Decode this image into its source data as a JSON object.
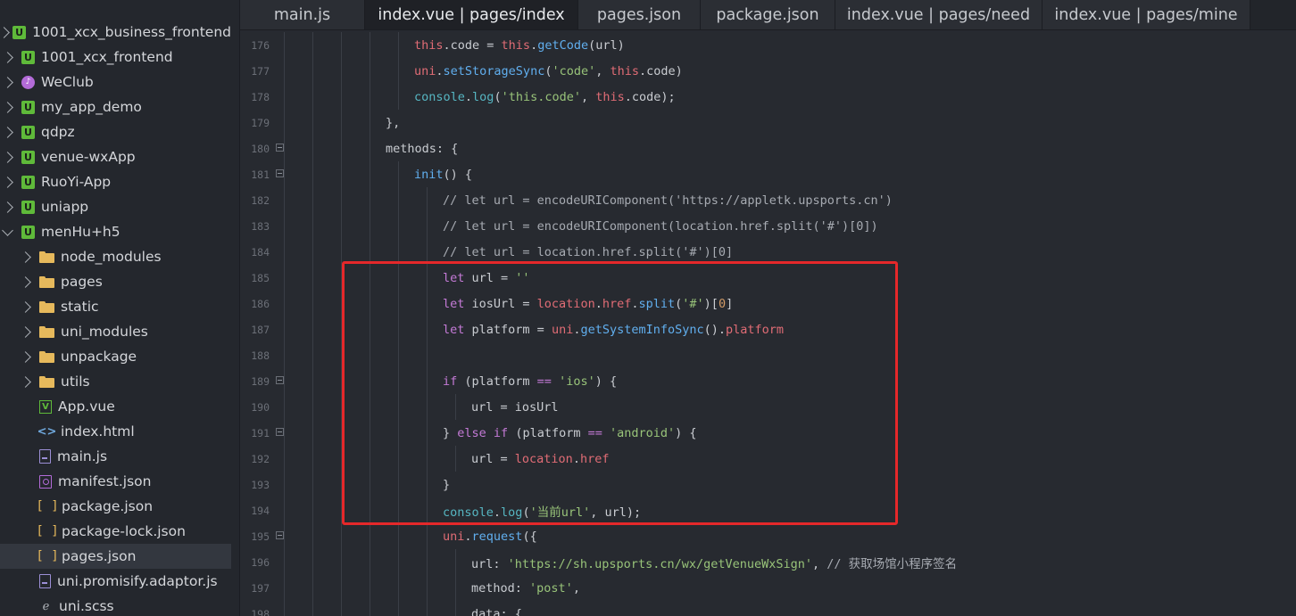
{
  "sidebar": {
    "items": [
      {
        "label": "1001_xcx_business_frontend",
        "icon": "uniapp-project-icon",
        "chevron": "right",
        "indent": 0,
        "selected": false
      },
      {
        "label": "1001_xcx_frontend",
        "icon": "uniapp-project-icon",
        "chevron": "right",
        "indent": 0,
        "selected": false
      },
      {
        "label": "WeClub",
        "icon": "weclub-project-icon",
        "chevron": "right",
        "indent": 0,
        "selected": false
      },
      {
        "label": "my_app_demo",
        "icon": "uniapp-project-icon",
        "chevron": "right",
        "indent": 0,
        "selected": false
      },
      {
        "label": "qdpz",
        "icon": "uniapp-project-icon",
        "chevron": "right",
        "indent": 0,
        "selected": false
      },
      {
        "label": "venue-wxApp",
        "icon": "uniapp-project-icon",
        "chevron": "right",
        "indent": 0,
        "selected": false
      },
      {
        "label": "RuoYi-App",
        "icon": "uniapp-project-icon",
        "chevron": "right",
        "indent": 0,
        "selected": false
      },
      {
        "label": "uniapp",
        "icon": "uniapp-project-icon",
        "chevron": "right",
        "indent": 0,
        "selected": false
      },
      {
        "label": "menHu+h5",
        "icon": "uniapp-project-icon",
        "chevron": "down",
        "indent": 0,
        "selected": false
      },
      {
        "label": "node_modules",
        "icon": "folder-icon",
        "chevron": "right",
        "indent": 1,
        "selected": false
      },
      {
        "label": "pages",
        "icon": "folder-icon",
        "chevron": "right",
        "indent": 1,
        "selected": false
      },
      {
        "label": "static",
        "icon": "folder-icon",
        "chevron": "right",
        "indent": 1,
        "selected": false
      },
      {
        "label": "uni_modules",
        "icon": "folder-icon",
        "chevron": "right",
        "indent": 1,
        "selected": false
      },
      {
        "label": "unpackage",
        "icon": "folder-icon",
        "chevron": "right",
        "indent": 1,
        "selected": false
      },
      {
        "label": "utils",
        "icon": "folder-icon",
        "chevron": "right",
        "indent": 1,
        "selected": false
      },
      {
        "label": "App.vue",
        "icon": "vue-file-icon",
        "chevron": "",
        "indent": 1,
        "selected": false
      },
      {
        "label": "index.html",
        "icon": "html-file-icon",
        "chevron": "",
        "indent": 1,
        "selected": false
      },
      {
        "label": "main.js",
        "icon": "js-file-icon",
        "chevron": "",
        "indent": 1,
        "selected": false
      },
      {
        "label": "manifest.json",
        "icon": "manifest-file-icon",
        "chevron": "",
        "indent": 1,
        "selected": false
      },
      {
        "label": "package.json",
        "icon": "json-file-icon",
        "chevron": "",
        "indent": 1,
        "selected": false
      },
      {
        "label": "package-lock.json",
        "icon": "json-file-icon",
        "chevron": "",
        "indent": 1,
        "selected": false
      },
      {
        "label": "pages.json",
        "icon": "json-file-icon",
        "chevron": "",
        "indent": 1,
        "selected": true
      },
      {
        "label": "uni.promisify.adaptor.js",
        "icon": "js-file-icon",
        "chevron": "",
        "indent": 1,
        "selected": false
      },
      {
        "label": "uni.scss",
        "icon": "scss-file-icon",
        "chevron": "",
        "indent": 1,
        "selected": false
      }
    ]
  },
  "tabs": [
    {
      "label": "main.js",
      "active": false
    },
    {
      "label": "index.vue | pages/index",
      "active": true
    },
    {
      "label": "pages.json",
      "active": false
    },
    {
      "label": "package.json",
      "active": false
    },
    {
      "label": "index.vue | pages/need",
      "active": false
    },
    {
      "label": "index.vue | pages/mine",
      "active": false
    }
  ],
  "colors": {
    "keyword": "#c47ad6",
    "this": "#e06c75",
    "function": "#61afef",
    "object": "#56b6c2",
    "string": "#98c379",
    "comment": "#a7abb2",
    "highlight_box": "#e5282a"
  },
  "editor": {
    "lines": [
      {
        "num": "176",
        "fold": false,
        "indent": 5,
        "tokens": [
          [
            "this",
            "this"
          ],
          [
            ".code = ",
            ""
          ],
          [
            "this",
            "this"
          ],
          [
            ".",
            ""
          ],
          [
            "getCode",
            "fn"
          ],
          [
            "(url)",
            ""
          ]
        ]
      },
      {
        "num": "177",
        "fold": false,
        "indent": 5,
        "tokens": [
          [
            "uni",
            "this"
          ],
          [
            ".",
            ""
          ],
          [
            "setStorageSync",
            "fn"
          ],
          [
            "(",
            ""
          ],
          [
            "'code'",
            "str"
          ],
          [
            ", ",
            ""
          ],
          [
            "this",
            "this"
          ],
          [
            ".code)",
            ""
          ]
        ]
      },
      {
        "num": "178",
        "fold": false,
        "indent": 5,
        "tokens": [
          [
            "console",
            "obj"
          ],
          [
            ".",
            ""
          ],
          [
            "log",
            "obj"
          ],
          [
            "(",
            ""
          ],
          [
            "'this.code'",
            "str"
          ],
          [
            ", ",
            ""
          ],
          [
            "this",
            "this"
          ],
          [
            ".code);",
            ""
          ]
        ]
      },
      {
        "num": "179",
        "fold": false,
        "indent": 4,
        "tokens": [
          [
            "},",
            ""
          ]
        ]
      },
      {
        "num": "180",
        "fold": true,
        "indent": 4,
        "tokens": [
          [
            "methods: {",
            ""
          ]
        ]
      },
      {
        "num": "181",
        "fold": true,
        "indent": 5,
        "tokens": [
          [
            "init",
            "fn"
          ],
          [
            "() {",
            ""
          ]
        ]
      },
      {
        "num": "182",
        "fold": false,
        "indent": 6,
        "tokens": [
          [
            "// let url = encodeURIComponent('https://appletk.upsports.cn')",
            "cm"
          ]
        ]
      },
      {
        "num": "183",
        "fold": false,
        "indent": 6,
        "tokens": [
          [
            "// let url = encodeURIComponent(location.href.split('#')[0])",
            "cm"
          ]
        ]
      },
      {
        "num": "184",
        "fold": false,
        "indent": 6,
        "tokens": [
          [
            "// let url = location.href.split('#')[0]",
            "cm"
          ]
        ]
      },
      {
        "num": "185",
        "fold": false,
        "indent": 6,
        "tokens": [
          [
            "let",
            "kw"
          ],
          [
            " url = ",
            ""
          ],
          [
            "''",
            "str"
          ]
        ]
      },
      {
        "num": "186",
        "fold": false,
        "indent": 6,
        "tokens": [
          [
            "let",
            "kw"
          ],
          [
            " iosUrl = ",
            ""
          ],
          [
            "location",
            "this"
          ],
          [
            ".",
            ""
          ],
          [
            "href",
            "this"
          ],
          [
            ".",
            ""
          ],
          [
            "split",
            "fn"
          ],
          [
            "(",
            ""
          ],
          [
            "'#'",
            "str"
          ],
          [
            ")[",
            ""
          ],
          [
            "0",
            "num"
          ],
          [
            "]",
            ""
          ]
        ]
      },
      {
        "num": "187",
        "fold": false,
        "indent": 6,
        "tokens": [
          [
            "let",
            "kw"
          ],
          [
            " platform = ",
            ""
          ],
          [
            "uni",
            "this"
          ],
          [
            ".",
            ""
          ],
          [
            "getSystemInfoSync",
            "fn"
          ],
          [
            "().",
            ""
          ],
          [
            "platform",
            "this"
          ]
        ]
      },
      {
        "num": "188",
        "fold": false,
        "indent": 6,
        "tokens": []
      },
      {
        "num": "189",
        "fold": true,
        "indent": 6,
        "tokens": [
          [
            "if",
            "kw"
          ],
          [
            " (platform ",
            ""
          ],
          [
            "==",
            "kw"
          ],
          [
            " ",
            ""
          ],
          [
            "'ios'",
            "str"
          ],
          [
            ") {",
            ""
          ]
        ]
      },
      {
        "num": "190",
        "fold": false,
        "indent": 7,
        "tokens": [
          [
            "url = iosUrl",
            ""
          ]
        ]
      },
      {
        "num": "191",
        "fold": true,
        "indent": 6,
        "tokens": [
          [
            "} ",
            ""
          ],
          [
            "else",
            "kw"
          ],
          [
            " ",
            ""
          ],
          [
            "if",
            "kw"
          ],
          [
            " (platform ",
            ""
          ],
          [
            "==",
            "kw"
          ],
          [
            " ",
            ""
          ],
          [
            "'android'",
            "str"
          ],
          [
            ") {",
            ""
          ]
        ]
      },
      {
        "num": "192",
        "fold": false,
        "indent": 7,
        "tokens": [
          [
            "url = ",
            ""
          ],
          [
            "location",
            "this"
          ],
          [
            ".",
            ""
          ],
          [
            "href",
            "this"
          ]
        ]
      },
      {
        "num": "193",
        "fold": false,
        "indent": 6,
        "tokens": [
          [
            "}",
            ""
          ]
        ]
      },
      {
        "num": "194",
        "fold": false,
        "indent": 6,
        "tokens": [
          [
            "console",
            "obj"
          ],
          [
            ".",
            ""
          ],
          [
            "log",
            "obj"
          ],
          [
            "(",
            ""
          ],
          [
            "'当前url'",
            "str"
          ],
          [
            ", url);",
            ""
          ]
        ]
      },
      {
        "num": "195",
        "fold": true,
        "indent": 6,
        "tokens": [
          [
            "uni",
            "this"
          ],
          [
            ".",
            ""
          ],
          [
            "request",
            "fn"
          ],
          [
            "({",
            ""
          ]
        ]
      },
      {
        "num": "196",
        "fold": false,
        "indent": 7,
        "tokens": [
          [
            "url: ",
            ""
          ],
          [
            "'https://sh.upsports.cn/wx/getVenueWxSign'",
            "str"
          ],
          [
            ", ",
            ""
          ],
          [
            "// 获取场馆小程序签名",
            "cm"
          ]
        ]
      },
      {
        "num": "197",
        "fold": false,
        "indent": 7,
        "tokens": [
          [
            "method: ",
            ""
          ],
          [
            "'post'",
            "str"
          ],
          [
            ",",
            ""
          ]
        ]
      },
      {
        "num": "198",
        "fold": false,
        "indent": 7,
        "tokens": [
          [
            "data: {",
            ""
          ]
        ]
      }
    ]
  }
}
